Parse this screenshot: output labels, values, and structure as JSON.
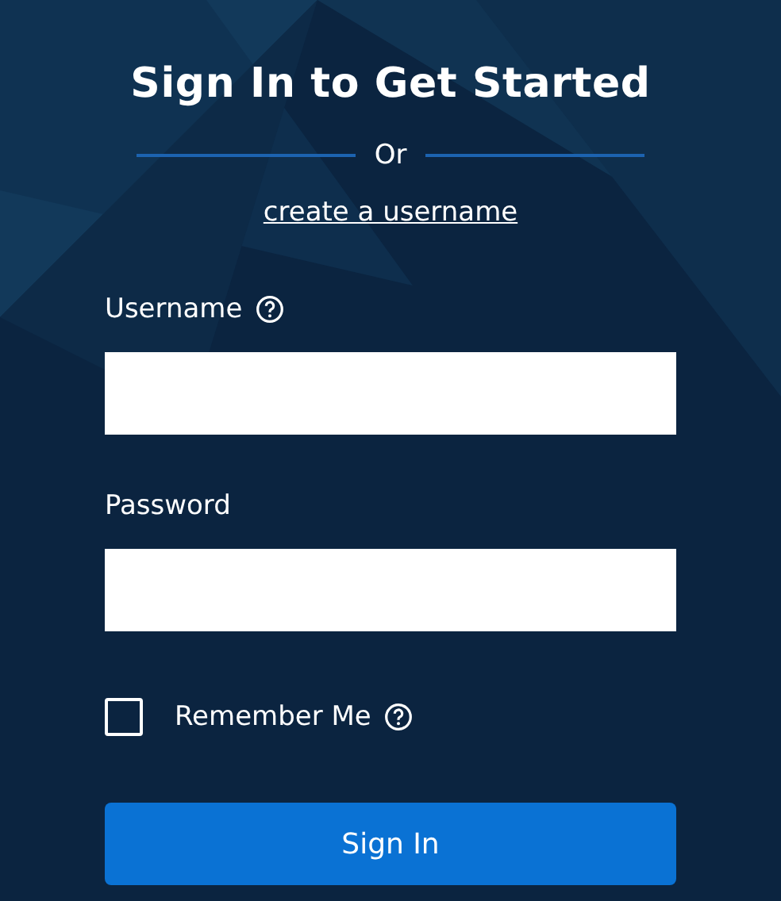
{
  "title": "Sign In to Get Started",
  "divider_text": "Or",
  "create_link": "create a username",
  "fields": [
    {
      "label": "Username",
      "has_help": true
    },
    {
      "label": "Password",
      "has_help": false
    }
  ],
  "remember": {
    "label": "Remember Me",
    "has_help": true,
    "checked": false
  },
  "submit": "Sign In"
}
